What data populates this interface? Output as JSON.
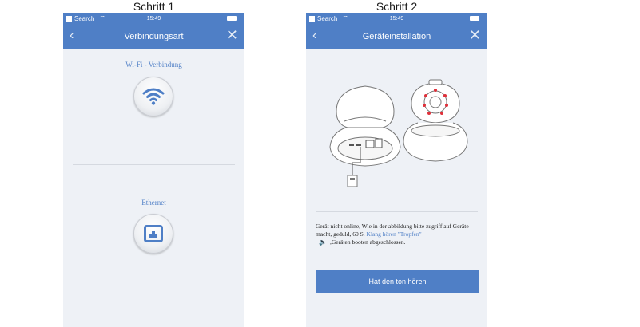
{
  "steps": {
    "step1_title": "Schritt 1",
    "step2_title": "Schritt 2"
  },
  "statusbar": {
    "carrier": "Search",
    "time": "15:49"
  },
  "screen1": {
    "nav_title": "Verbindungsart",
    "wifi_label": "Wi-Fi - Verbindung",
    "ethernet_label": "Ethernet"
  },
  "screen2": {
    "nav_title": "Geräteinstallation",
    "description_text": "Gerät nicht online, Wie in der abbildung bitte zugriff auf Geräte macht, geduld, 60 S.",
    "link_text": "Klang hören \"Tropfen\"",
    "description_tail": ",Geräten booten abgeschlossen.",
    "button_label": "Hat den ton hören"
  },
  "icons": {
    "back": "chevron-left-icon",
    "close": "close-icon",
    "wifi": "wifi-icon",
    "ethernet": "ethernet-port-icon",
    "speaker": "speaker-icon"
  },
  "colors": {
    "accent": "#4f7fc6",
    "background": "#eef1f6",
    "led": "#e0303a"
  }
}
